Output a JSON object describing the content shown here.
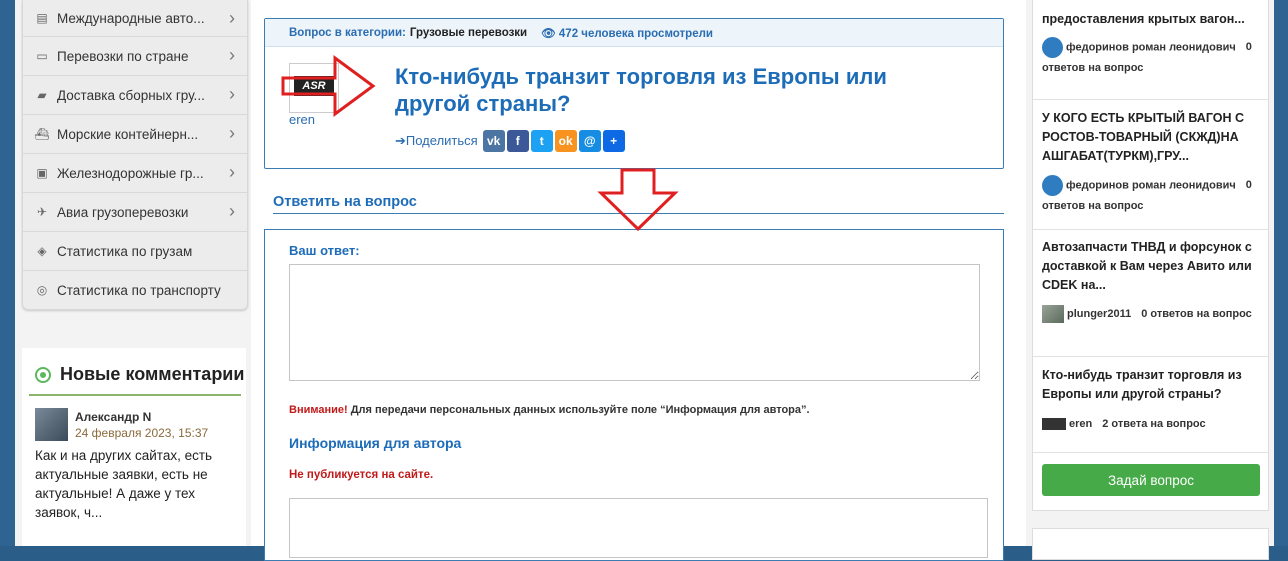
{
  "menu": {
    "items": [
      {
        "label": "Международные авто...",
        "icon": "truck-icon",
        "glyph": "▤",
        "chevron": true
      },
      {
        "label": "Перевозки по стране",
        "icon": "bus-icon",
        "glyph": "▭",
        "chevron": true
      },
      {
        "label": "Доставка сборных гру...",
        "icon": "delivery-truck-icon",
        "glyph": "▰",
        "chevron": true
      },
      {
        "label": "Морские контейнерн...",
        "icon": "ship-icon",
        "glyph": "⛴",
        "chevron": true
      },
      {
        "label": "Железнодорожные гр...",
        "icon": "train-icon",
        "glyph": "▣",
        "chevron": true
      },
      {
        "label": "Авиа грузоперевозки",
        "icon": "airplane-icon",
        "glyph": "✈",
        "chevron": true
      },
      {
        "label": "Статистика по грузам",
        "icon": "cube-icon",
        "glyph": "◈",
        "chevron": false
      },
      {
        "label": "Статистика по транспорту",
        "icon": "dashboard-icon",
        "glyph": "◎",
        "chevron": false
      }
    ]
  },
  "comments": {
    "heading": "Новые комментарии",
    "item": {
      "author": "Александр N",
      "date": "24 февраля 2023, 15:37",
      "text": "Как и на других сайтах, есть актуальные заявки, есть не актуальные! А даже у тех заявок, ч..."
    }
  },
  "question": {
    "meta_label": "Вопрос в категории:",
    "category": "Грузовые перевозки",
    "views": "472 человека просмотрели",
    "views_icon": "eye-icon",
    "avatar_text": "ASR",
    "author": "eren",
    "title": "Кто-нибудь транзит торговля из Европы или другой страны?",
    "share_label": "➔Поделиться"
  },
  "share_buttons": [
    {
      "name": "vk-share-button",
      "icon": "vk-icon",
      "glyph": "vk",
      "color": "#4c75a3"
    },
    {
      "name": "facebook-share-button",
      "icon": "facebook-icon",
      "glyph": "f",
      "color": "#3b5998"
    },
    {
      "name": "twitter-share-button",
      "icon": "twitter-icon",
      "glyph": "t",
      "color": "#1da1f2"
    },
    {
      "name": "odnoklassniki-share-button",
      "icon": "odnoklassniki-icon",
      "glyph": "ok",
      "color": "#f7931e"
    },
    {
      "name": "mail-share-button",
      "icon": "at-icon",
      "glyph": "@",
      "color": "#168de2"
    },
    {
      "name": "more-share-button",
      "icon": "plus-icon",
      "glyph": "+",
      "color": "#0d6ae4"
    }
  ],
  "answer": {
    "section_title": "Ответить на вопрос",
    "label": "Ваш ответ:",
    "warning_label": "Внимание!",
    "warning_text": " Для передачи персональных данных используйте поле “Информация для автора”.",
    "info_title": "Информация для автора",
    "not_published": "Не публикуется на сайте."
  },
  "sidebar_questions": [
    {
      "title": "предоставления крытых вагон...",
      "author": "федоринов роман леонидович",
      "answers": "0 ответов на вопрос",
      "avatar": "badge"
    },
    {
      "title": "У КОГО ЕСТЬ КРЫТЫЙ ВАГОН С РОСТОВ-ТОВАРНЫЙ (СКЖД)НА АШГАБАТ(ТУРКМ),ГРУ...",
      "author": "федоринов роман леонидович",
      "answers": "0 ответов на вопрос",
      "avatar": "badge"
    },
    {
      "title": "Автозапчасти ТНВД и форсунок с доставкой к Вам через Авито или CDEK на...",
      "author": "plunger2011",
      "answers": "0 ответов на вопрос",
      "avatar": "thumb"
    },
    {
      "title": "Кто-нибудь транзит торговля из Европы или другой страны?",
      "author": "eren",
      "answers": "2 ответа на вопрос",
      "avatar": "asr"
    }
  ],
  "ask_button": "Задай вопрос",
  "annotations": {
    "color": "#e02020",
    "arrows": [
      "right-arrow",
      "down-arrow"
    ]
  }
}
